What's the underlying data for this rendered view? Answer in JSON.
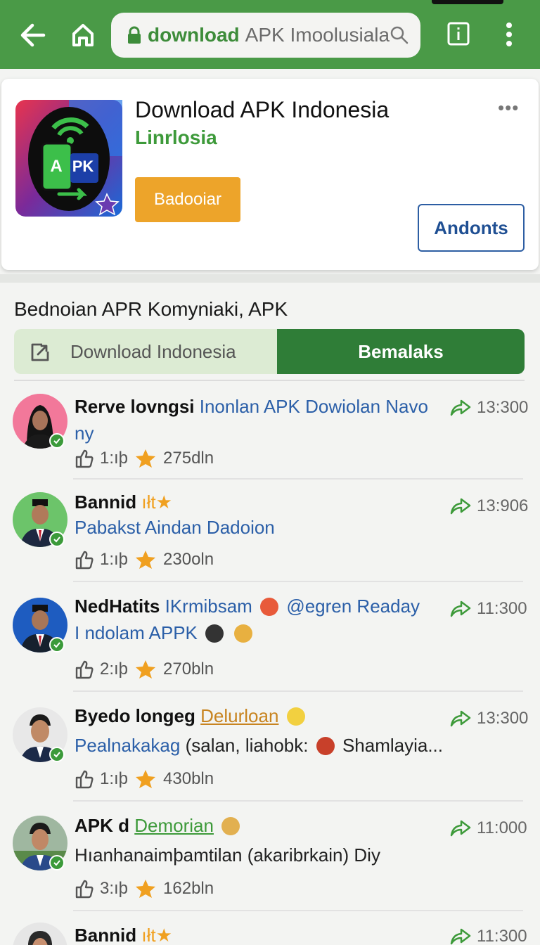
{
  "browser": {
    "url_highlight": "download",
    "url_rest": "APK Imoolusiala"
  },
  "app": {
    "title": "Download APK Indonesia",
    "subtitle": "Linrlosia",
    "icon_text": "APK",
    "more_label": "•••",
    "install_label": "Badooiar",
    "android_label": "Andonts"
  },
  "section_title": "Bednoian APR Komyniaki, APK",
  "tabs": [
    {
      "label": "Download Indonesia"
    },
    {
      "label": "Bemalaks"
    }
  ],
  "posts": [
    {
      "name": "Rerve lovngsi",
      "name_extra": "",
      "line1": "Inonlan APK Dowiolan Navo",
      "line2": "ny",
      "likes": "1:ıþ",
      "views": "275dln",
      "time": "13:300"
    },
    {
      "name": "Bannid",
      "name_extra": "ıłt★",
      "line1": "",
      "line2": "Pabakst Aindan Dadoion",
      "likes": "1:ıþ",
      "views": "230oln",
      "time": "13:906"
    },
    {
      "name": "NedHatits",
      "name_extra": "",
      "line1": "IKrmibsam",
      "line1b": "@egren Readay",
      "line2": "I ndolam APPK",
      "likes": "2:ıþ",
      "views": "270bln",
      "time": "11:300"
    },
    {
      "name": "Byedo longeg",
      "name_extra": "",
      "line1": "Delurloan",
      "line2": "Pealnakakag",
      "line2b": "(salan, liahobk:",
      "line2c": "Shamlayia...",
      "likes": "1:ıþ",
      "views": "430bln",
      "time": "13:300"
    },
    {
      "name": "APK d",
      "name_extra": "",
      "line1": "Demorian",
      "line2": "Hıanhanaimþamtilan (akaribrkain) Diy",
      "likes": "3:ıþ",
      "views": "162bln",
      "time": "11:000"
    },
    {
      "name": "Bannid",
      "name_extra": "ıłt★",
      "time": "11:300"
    }
  ],
  "colors": {
    "topbar": "#4a9a47",
    "accent_green": "#2f7d37",
    "install_orange": "#eda42a",
    "link_blue": "#2b5fa8"
  }
}
